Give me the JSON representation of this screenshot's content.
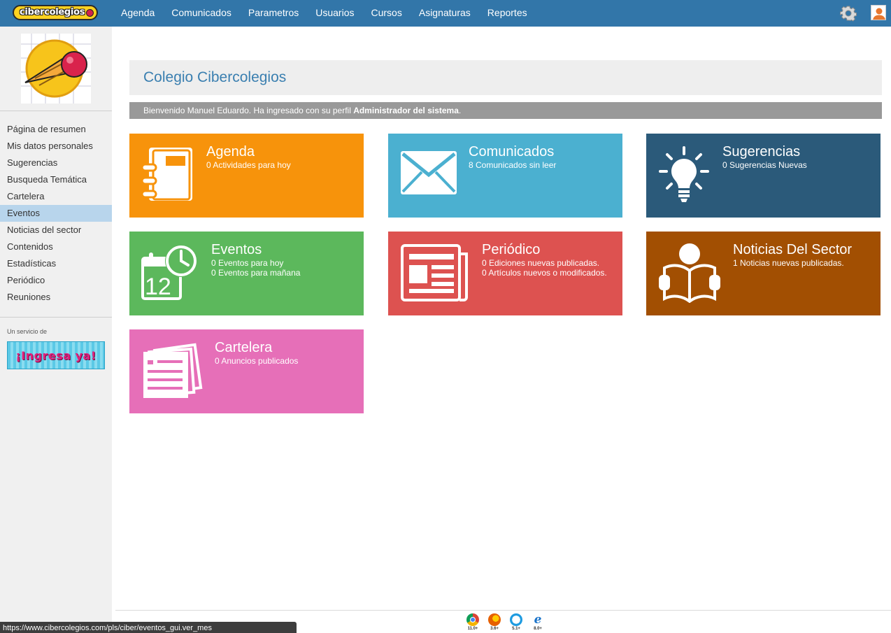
{
  "topbar": {
    "logo_text": "cibercolegios",
    "nav": [
      "Agenda",
      "Comunicados",
      "Parametros",
      "Usuarios",
      "Cursos",
      "Asignaturas",
      "Reportes"
    ],
    "bg_color": "#3276a9"
  },
  "sidebar": {
    "items": [
      {
        "label": "Página de resumen"
      },
      {
        "label": "Mis datos personales"
      },
      {
        "label": "Sugerencias"
      },
      {
        "label": "Busqueda Temática"
      },
      {
        "label": "Cartelera"
      },
      {
        "label": "Eventos",
        "active": true
      },
      {
        "label": "Noticias del sector"
      },
      {
        "label": "Contenidos"
      },
      {
        "label": "Estadísticas"
      },
      {
        "label": "Periódico"
      },
      {
        "label": "Reuniones"
      }
    ],
    "service_label": "Un servicio de",
    "banner_text": "¡Ingresa ya!"
  },
  "main": {
    "school_name": "Colegio Cibercolegios",
    "welcome_prefix": "Bienvenido Manuel Eduardo. Ha ingresado con su perfil ",
    "welcome_role": "Administrador del sistema",
    "welcome_suffix": "."
  },
  "tiles": [
    {
      "title": "Agenda",
      "lines": [
        "0 Actividades para hoy"
      ],
      "color": "#f7930b",
      "icon": "notebook-icon"
    },
    {
      "title": "Comunicados",
      "lines": [
        "8 Comunicados sin leer"
      ],
      "color": "#4bb0d0",
      "icon": "envelope-icon"
    },
    {
      "title": "Sugerencias",
      "lines": [
        "0 Sugerencias Nuevas"
      ],
      "color": "#2b5a7a",
      "icon": "lightbulb-icon"
    },
    {
      "title": "Eventos",
      "lines": [
        "0 Eventos para hoy",
        "0 Eventos para mañana"
      ],
      "color": "#5cb85c",
      "icon": "calendar-clock-icon"
    },
    {
      "title": "Periódico",
      "lines": [
        "0 Ediciones nuevas publicadas.",
        "0 Artículos nuevos o modificados."
      ],
      "color": "#dd5250",
      "icon": "newspaper-icon"
    },
    {
      "title": "Noticias Del Sector",
      "lines": [
        "1 Noticias nuevas publicadas."
      ],
      "color": "#a24f02",
      "icon": "reader-icon"
    },
    {
      "title": "Cartelera",
      "lines": [
        "0 Anuncios publicados"
      ],
      "color": "#e66fb8",
      "icon": "documents-icon"
    }
  ],
  "browsers": [
    {
      "name": "chrome-icon",
      "version": "11.0+",
      "color": "#db4437"
    },
    {
      "name": "firefox-icon",
      "version": "3.6+",
      "color": "#e66000"
    },
    {
      "name": "safari-icon",
      "version": "5.1+",
      "color": "#1e9be0"
    },
    {
      "name": "ie-icon",
      "version": "8.0+",
      "color": "#1a73c9"
    }
  ],
  "status_url": "https://www.cibercolegios.com/pls/ciber/eventos_gui.ver_mes"
}
